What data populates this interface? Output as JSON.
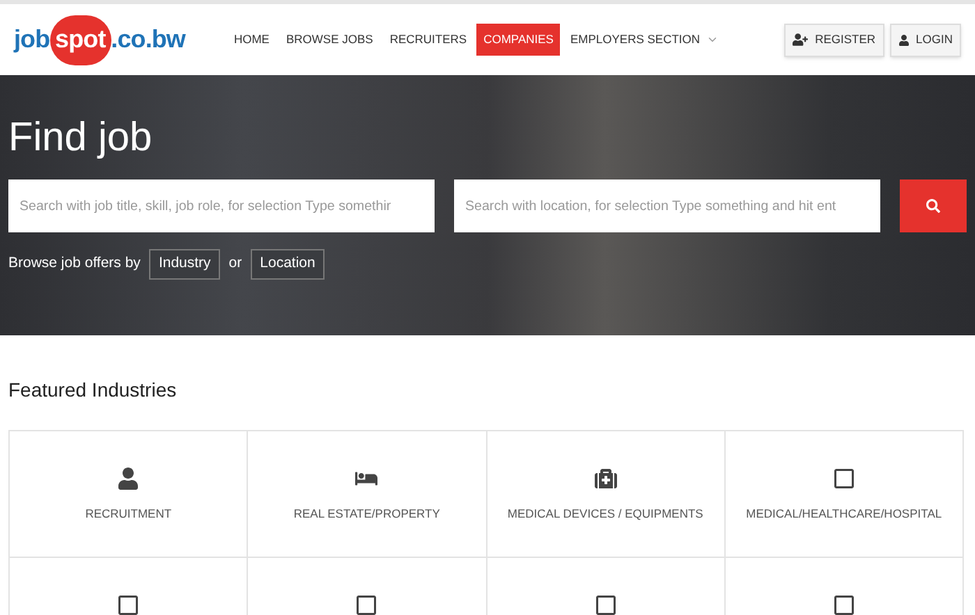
{
  "logo": {
    "prefix": "job",
    "highlight": "spot",
    "suffix": ".co.bw"
  },
  "nav": [
    {
      "label": "HOME",
      "selected": false,
      "kind": "link"
    },
    {
      "label": "BROWSE JOBS",
      "selected": false,
      "kind": "link"
    },
    {
      "label": "RECRUITERS",
      "selected": false,
      "kind": "link"
    },
    {
      "label": "COMPANIES",
      "selected": true,
      "kind": "link"
    },
    {
      "label": "EMPLOYERS SECTION",
      "selected": false,
      "kind": "dropdown"
    }
  ],
  "account_buttons": [
    {
      "label": "REGISTER",
      "kind": "register"
    },
    {
      "label": "LOGIN",
      "kind": "login"
    }
  ],
  "hero": {
    "title": "Find job",
    "search_fields": [
      {
        "placeholder": "Search with job title, skill, job role, for selection Type somethir"
      },
      {
        "placeholder": "Search with location, for selection Type something and hit ent"
      }
    ],
    "browse_text": "Browse job offers by",
    "browse_options": [
      "Industry",
      "Location"
    ],
    "or_text": "or"
  },
  "featured": {
    "title": "Featured Industries",
    "industries": [
      {
        "kind": "person",
        "label": "RECRUITMENT"
      },
      {
        "kind": "bed",
        "label": "REAL ESTATE/PROPERTY"
      },
      {
        "kind": "medkit",
        "label": "MEDICAL DEVICES / EQUIPMENTS"
      },
      {
        "kind": "square",
        "label": "MEDICAL/HEALTHCARE/HOSPITAL"
      },
      {
        "kind": "square"
      },
      {
        "kind": "square"
      },
      {
        "kind": "square"
      },
      {
        "kind": "square"
      }
    ]
  }
}
